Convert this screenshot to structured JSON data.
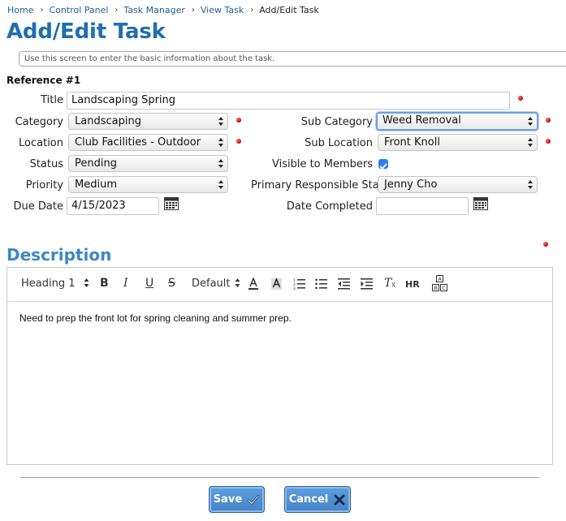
{
  "breadcrumb": {
    "items": [
      "Home",
      "Control Panel",
      "Task Manager",
      "View Task"
    ],
    "current": "Add/Edit Task",
    "separator": "›"
  },
  "page_title": "Add/Edit Task",
  "info_text": "Use this screen to enter the basic information about the task.",
  "reference": "Reference #1",
  "form": {
    "title": {
      "label": "Title",
      "value": "Landscaping Spring"
    },
    "category": {
      "label": "Category",
      "value": "Landscaping"
    },
    "sub_category": {
      "label": "Sub Category",
      "value": "Weed Removal"
    },
    "location": {
      "label": "Location",
      "value": "Club Facilities - Outdoor"
    },
    "sub_location": {
      "label": "Sub Location",
      "value": "Front Knoll"
    },
    "status": {
      "label": "Status",
      "value": "Pending"
    },
    "visible_to_members": {
      "label": "Visible to Members",
      "checked": true
    },
    "priority": {
      "label": "Priority",
      "value": "Medium"
    },
    "primary_responsible": {
      "label": "Primary Responsible Staf",
      "value": "Jenny Cho"
    },
    "due_date": {
      "label": "Due Date",
      "value": "4/15/2023"
    },
    "date_completed": {
      "label": "Date Completed",
      "value": ""
    }
  },
  "description": {
    "heading": "Description",
    "toolbar": {
      "heading_select": "Heading 1",
      "font_select": "Default",
      "hr_label": "HR",
      "buttons": [
        "bold-icon",
        "italic-icon",
        "underline-icon",
        "strikethrough-icon",
        "text-color-icon",
        "highlight-icon",
        "ordered-list-icon",
        "unordered-list-icon",
        "outdent-icon",
        "indent-icon",
        "clear-format-icon",
        "horizontal-rule-icon",
        "special-chars-icon"
      ]
    },
    "content": "Need to prep the front lot for spring cleaning and summer prep."
  },
  "buttons": {
    "save": "Save",
    "cancel": "Cancel"
  },
  "colors": {
    "title_blue": "#1e6fae",
    "link_blue": "#1d5f96",
    "button_blue": "#4682c7",
    "required_red": "#c40000",
    "checkbox_blue": "#2e7cf6"
  }
}
